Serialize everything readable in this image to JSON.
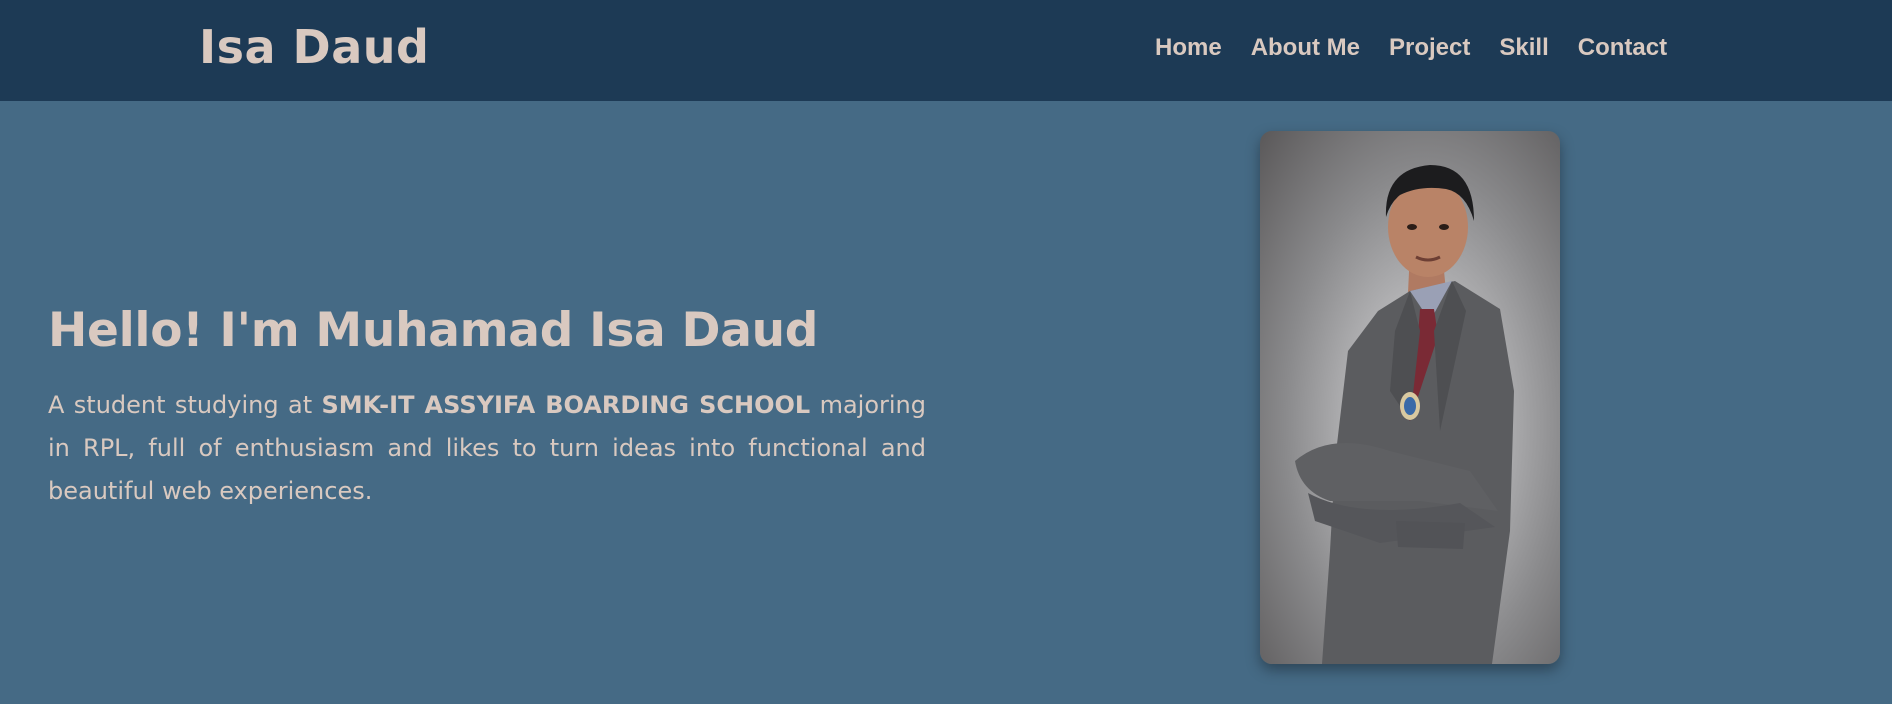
{
  "nav": {
    "brand": "Isa Daud",
    "links": [
      "Home",
      "About Me",
      "Project",
      "Skill",
      "Contact"
    ]
  },
  "hero": {
    "title": "Hello! I'm Muhamad Isa Daud",
    "desc_before": "A student studying at ",
    "desc_bold": "SMK-IT ASSYIFA BOARDING SCHOOL",
    "desc_after": " majoring in RPL, full of enthusiasm and likes to turn ideas into functional and beautiful web experiences."
  },
  "colors": {
    "navbar_bg": "#1d3a55",
    "page_bg": "#456a85",
    "text": "#d9c9c0"
  }
}
